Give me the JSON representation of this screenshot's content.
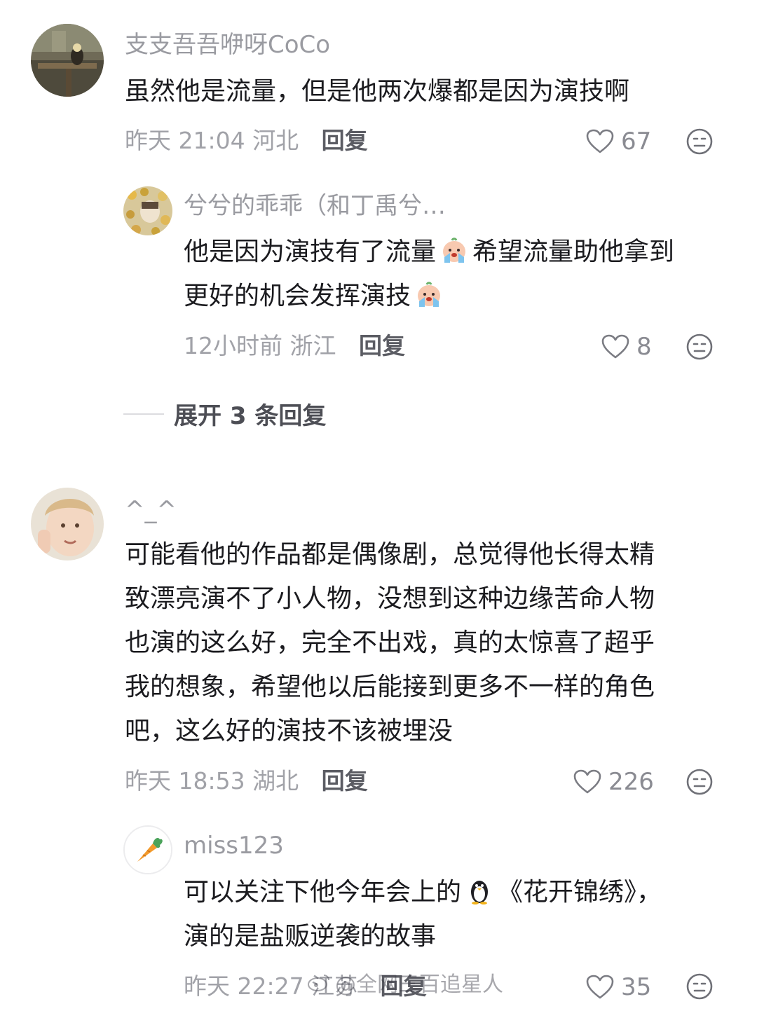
{
  "comments": [
    {
      "username": "支支吾吾咿呀CoCo",
      "lines": [
        "虽然他是流量，但是他两次爆都是因为演技啊"
      ],
      "time": "昨天 21:04",
      "location": "河北",
      "reply_label": "回复",
      "likes": "67",
      "replies": [
        {
          "username": "兮兮的乖乖（和丁禹兮…",
          "line1_a": "他是因为演技有了流量",
          "line1_b": "希望流量助他拿到",
          "line2": "更好的机会发挥演技",
          "time": "12小时前",
          "location": "浙江",
          "reply_label": "回复",
          "likes": "8"
        }
      ],
      "expand_label": "展开 3 条回复"
    },
    {
      "username": "^_^",
      "lines": [
        "可能看他的作品都是偶像剧，总觉得他长得太精",
        "致漂亮演不了小人物，没想到这种边缘苦命人物",
        "也演的这么好，完全不出戏，真的太惊喜了超乎",
        "我的想象，希望他以后能接到更多不一样的角色",
        "吧，这么好的演技不该被埋没"
      ],
      "time": "昨天 18:53",
      "location": "湖北",
      "reply_label": "回复",
      "likes": "226",
      "replies": [
        {
          "username": "miss123",
          "line1_a": "可以关注下他今年会上的",
          "line1_b": "《花开锦绣》，",
          "line2": "演的是盐贩逆袭的故事",
          "time": "昨天 22:27",
          "location": "江苏",
          "reply_label": "回复",
          "likes": "35"
        }
      ]
    }
  ],
  "watermark": "@全网三百追星人",
  "colors": {
    "muted_text": "#9a9ba1",
    "body_text": "#1b1b1f",
    "reply_label": "#5b5c63"
  }
}
